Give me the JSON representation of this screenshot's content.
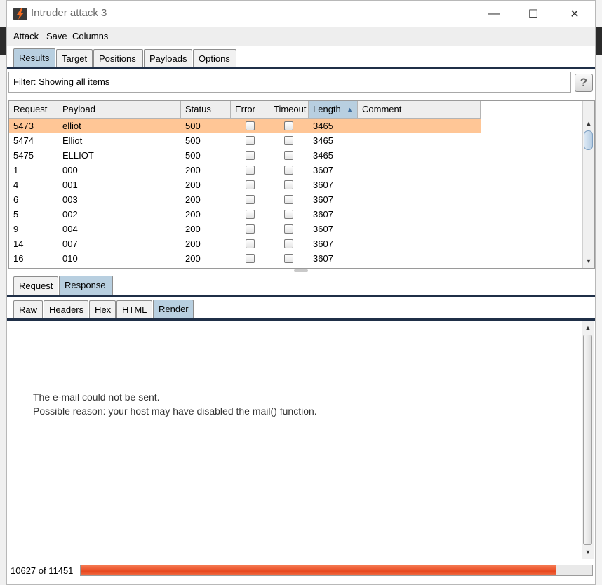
{
  "window": {
    "title": "Intruder attack 3",
    "controls": {
      "minimize": "—",
      "maximize": "☐",
      "close": "✕"
    }
  },
  "menu": [
    "Attack",
    "Save",
    "Columns"
  ],
  "tabs": {
    "main": [
      "Results",
      "Target",
      "Positions",
      "Payloads",
      "Options"
    ],
    "main_active": "Results",
    "pane": [
      "Request",
      "Response"
    ],
    "pane_active": "Response",
    "view": [
      "Raw",
      "Headers",
      "Hex",
      "HTML",
      "Render"
    ],
    "view_active": "Render"
  },
  "filter": {
    "text": "Filter: Showing all items",
    "help_label": "?"
  },
  "table": {
    "columns": [
      "Request",
      "Payload",
      "Status",
      "Error",
      "Timeout",
      "Length",
      "Comment"
    ],
    "sorted_column": "Length",
    "sort_direction": "ascending",
    "rows": [
      {
        "request": "5473",
        "payload": "elliot",
        "status": "500",
        "error": false,
        "timeout": false,
        "length": "3465",
        "comment": "",
        "selected": true
      },
      {
        "request": "5474",
        "payload": "Elliot",
        "status": "500",
        "error": false,
        "timeout": false,
        "length": "3465",
        "comment": ""
      },
      {
        "request": "5475",
        "payload": "ELLIOT",
        "status": "500",
        "error": false,
        "timeout": false,
        "length": "3465",
        "comment": ""
      },
      {
        "request": "1",
        "payload": "000",
        "status": "200",
        "error": false,
        "timeout": false,
        "length": "3607",
        "comment": ""
      },
      {
        "request": "4",
        "payload": "001",
        "status": "200",
        "error": false,
        "timeout": false,
        "length": "3607",
        "comment": ""
      },
      {
        "request": "6",
        "payload": "003",
        "status": "200",
        "error": false,
        "timeout": false,
        "length": "3607",
        "comment": ""
      },
      {
        "request": "5",
        "payload": "002",
        "status": "200",
        "error": false,
        "timeout": false,
        "length": "3607",
        "comment": ""
      },
      {
        "request": "9",
        "payload": "004",
        "status": "200",
        "error": false,
        "timeout": false,
        "length": "3607",
        "comment": ""
      },
      {
        "request": "14",
        "payload": "007",
        "status": "200",
        "error": false,
        "timeout": false,
        "length": "3607",
        "comment": ""
      },
      {
        "request": "16",
        "payload": "010",
        "status": "200",
        "error": false,
        "timeout": false,
        "length": "3607",
        "comment": ""
      }
    ]
  },
  "response": {
    "lines": [
      "The e-mail could not be sent.",
      "Possible reason: your host may have disabled the mail() function."
    ]
  },
  "status": {
    "progress_text": "10627 of 11451",
    "progress_fraction": 0.928
  },
  "colors": {
    "selected_row": "#ffc696",
    "active_tab": "#b8cfe0",
    "progress_fill": "#e8481f",
    "tab_divider": "#1f2f47"
  }
}
